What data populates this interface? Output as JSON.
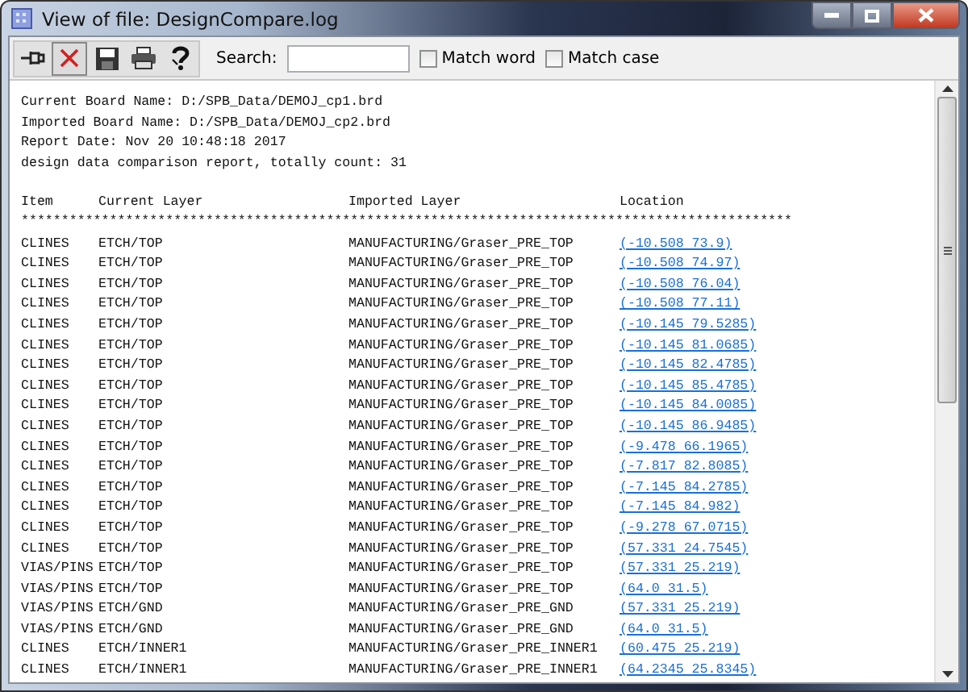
{
  "window": {
    "title": "View of file: DesignCompare.log"
  },
  "toolbar": {
    "search": {
      "label": "Search:"
    },
    "options": [
      {
        "label": "Match word",
        "checked": false
      },
      {
        "label": "Match case",
        "checked": false
      }
    ]
  },
  "header_lines": [
    "Current Board Name: D:/SPB_Data/DEMOJ_cp1.brd",
    "Imported Board Name: D:/SPB_Data/DEMOJ_cp2.brd",
    "Report Date: Nov 20 10:48:18 2017",
    "design data comparison report, totally count: 31"
  ],
  "table": {
    "columns": [
      "Item",
      "Current Layer",
      "Imported Layer",
      "Location"
    ],
    "separator": "************************************************************************************************",
    "rows": [
      [
        "CLINES",
        "ETCH/TOP",
        "MANUFACTURING/Graser_PRE_TOP",
        "(-10.508 73.9)"
      ],
      [
        "CLINES",
        "ETCH/TOP",
        "MANUFACTURING/Graser_PRE_TOP",
        "(-10.508 74.97)"
      ],
      [
        "CLINES",
        "ETCH/TOP",
        "MANUFACTURING/Graser_PRE_TOP",
        "(-10.508 76.04)"
      ],
      [
        "CLINES",
        "ETCH/TOP",
        "MANUFACTURING/Graser_PRE_TOP",
        "(-10.508 77.11)"
      ],
      [
        "CLINES",
        "ETCH/TOP",
        "MANUFACTURING/Graser_PRE_TOP",
        "(-10.145 79.5285)"
      ],
      [
        "CLINES",
        "ETCH/TOP",
        "MANUFACTURING/Graser_PRE_TOP",
        "(-10.145 81.0685)"
      ],
      [
        "CLINES",
        "ETCH/TOP",
        "MANUFACTURING/Graser_PRE_TOP",
        "(-10.145 82.4785)"
      ],
      [
        "CLINES",
        "ETCH/TOP",
        "MANUFACTURING/Graser_PRE_TOP",
        "(-10.145 85.4785)"
      ],
      [
        "CLINES",
        "ETCH/TOP",
        "MANUFACTURING/Graser_PRE_TOP",
        "(-10.145 84.0085)"
      ],
      [
        "CLINES",
        "ETCH/TOP",
        "MANUFACTURING/Graser_PRE_TOP",
        "(-10.145 86.9485)"
      ],
      [
        "CLINES",
        "ETCH/TOP",
        "MANUFACTURING/Graser_PRE_TOP",
        "(-9.478 66.1965)"
      ],
      [
        "CLINES",
        "ETCH/TOP",
        "MANUFACTURING/Graser_PRE_TOP",
        "(-7.817 82.8085)"
      ],
      [
        "CLINES",
        "ETCH/TOP",
        "MANUFACTURING/Graser_PRE_TOP",
        "(-7.145 84.2785)"
      ],
      [
        "CLINES",
        "ETCH/TOP",
        "MANUFACTURING/Graser_PRE_TOP",
        "(-7.145 84.982)"
      ],
      [
        "CLINES",
        "ETCH/TOP",
        "MANUFACTURING/Graser_PRE_TOP",
        "(-9.278 67.0715)"
      ],
      [
        "CLINES",
        "ETCH/TOP",
        "MANUFACTURING/Graser_PRE_TOP",
        "(57.331 24.7545)"
      ],
      [
        "VIAS/PINS",
        "ETCH/TOP",
        "MANUFACTURING/Graser_PRE_TOP",
        "(57.331 25.219)"
      ],
      [
        "VIAS/PINS",
        "ETCH/TOP",
        "MANUFACTURING/Graser_PRE_TOP",
        "(64.0 31.5)"
      ],
      [
        "VIAS/PINS",
        "ETCH/GND",
        "MANUFACTURING/Graser_PRE_GND",
        "(57.331 25.219)"
      ],
      [
        "VIAS/PINS",
        "ETCH/GND",
        "MANUFACTURING/Graser_PRE_GND",
        "(64.0 31.5)"
      ],
      [
        "CLINES",
        "ETCH/INNER1",
        "MANUFACTURING/Graser_PRE_INNER1",
        "(60.475 25.219)"
      ],
      [
        "CLINES",
        "ETCH/INNER1",
        "MANUFACTURING/Graser_PRE_INNER1",
        "(64.2345 25.8345)"
      ]
    ]
  }
}
